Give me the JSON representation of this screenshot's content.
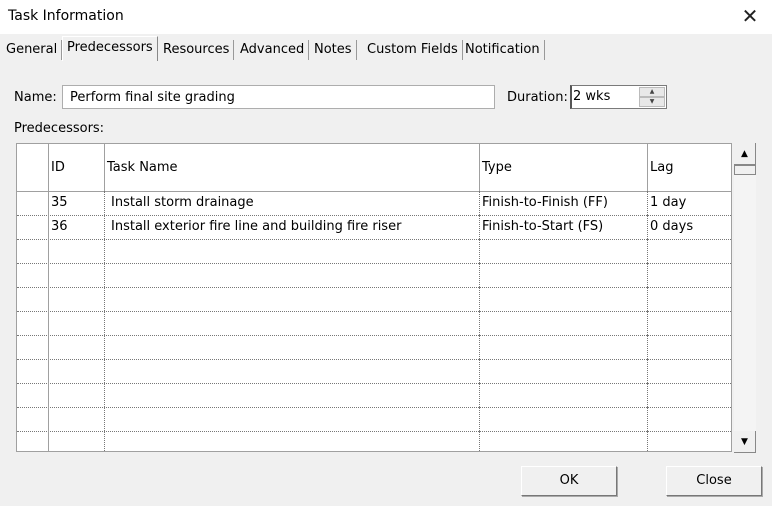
{
  "window": {
    "title": "Task Information",
    "close_icon": "close-icon"
  },
  "tabs": [
    {
      "label": "General",
      "active": false
    },
    {
      "label": "Predecessors",
      "active": true
    },
    {
      "label": "Resources",
      "active": false
    },
    {
      "label": "Advanced",
      "active": false
    },
    {
      "label": "Notes",
      "active": false
    },
    {
      "label": "Custom Fields",
      "active": false
    },
    {
      "label": "Notification",
      "active": false
    }
  ],
  "form": {
    "name_label": "Name:",
    "name_value": "Perform final site grading",
    "duration_label": "Duration:",
    "duration_value": "2 wks",
    "predecessors_label": "Predecessors:"
  },
  "table": {
    "columns": [
      "ID",
      "Task Name",
      "Type",
      "Lag"
    ],
    "rows": [
      {
        "id": "35",
        "task_name": "Install storm drainage",
        "type": "Finish-to-Finish (FF)",
        "lag": "1 day"
      },
      {
        "id": "36",
        "task_name": "Install exterior fire line and building fire riser",
        "type": "Finish-to-Start (FS)",
        "lag": "0 days"
      }
    ],
    "empty_rows": 9
  },
  "buttons": {
    "ok": "OK",
    "close": "Close"
  }
}
